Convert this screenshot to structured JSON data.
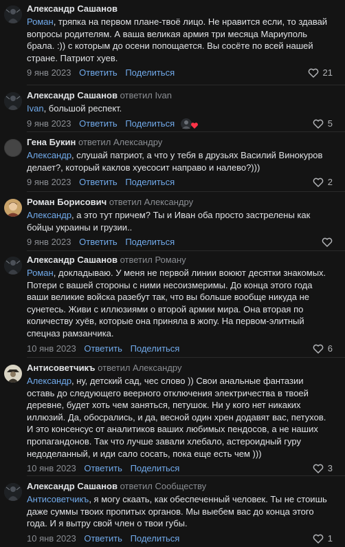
{
  "actions": {
    "reply": "Ответить",
    "share": "Поделиться"
  },
  "comments": [
    {
      "author": "Александр Сашанов",
      "reply_to": "",
      "mention": "Роман",
      "text": ", тряпка на первом плане-твоё лицо. Не нравится если, то здавай вопросы родителям. А ваша великая армия три месяца Мариуполь брала. :)) с которым до осени попощается. Вы сосёте по всей нашей стране. Патриот хуев.",
      "date": "9 янв 2023",
      "likes": "21",
      "avatar": "dark-figure-avatar"
    },
    {
      "author": "Александр Сашанов",
      "reply_to": "ответил Ivan",
      "mention": "Ivan",
      "text": ", большой респект.",
      "date": "9 янв 2023",
      "likes": "5",
      "avatar": "dark-figure-avatar"
    },
    {
      "author": "Гена Букин",
      "reply_to": "ответил Александру",
      "mention": "Александр",
      "text": ", слушай патриот, а что у тебя в друзьях Василий Винокуров делает?, который каклов хуесосит направо и налево?)))",
      "date": "9 янв 2023",
      "likes": "2",
      "avatar": "grey-circle-avatar"
    },
    {
      "author": "Роман Борисович",
      "reply_to": "ответил Александру",
      "mention": "Александр",
      "text": ", а это тут причем? Ты и Иван оба просто застрелены как бойцы украины и грузии..",
      "date": "9 янв 2023",
      "likes": "",
      "avatar": "person-photo-avatar"
    },
    {
      "author": "Александр Сашанов",
      "reply_to": "ответил Роману",
      "mention": "Роман",
      "text": ", докладываю. У меня не первой линии воюют десятки знакомых. Потери с вашей стороны с ними несоизмеримы. До конца этого года ваши великие войска разебут так, что вы больше вообще никуда не сунетесь. Живи с иллюзиями о второй армии мира. Она вторая по количеству хуёв, которые она приняла в жопу. На первом-элитный спецназ рамзанчика.",
      "date": "10 янв 2023",
      "likes": "6",
      "avatar": "dark-figure-avatar"
    },
    {
      "author": "Антисоветчикъ",
      "reply_to": "ответил Александру",
      "mention": "Александр",
      "text": ", ну, детский сад, чес слово )) Свои анальные фантазии оставь до следующего веерного отключения электричества в твоей деревне, будет хоть чем заняться, петушок. Ни у кого нет никаких иллюзий. Да, обосрались, и да, весной один хрен додавят вас, петухов. И это консенсус от аналитиков ваших любимых пендосов, а не наших пропагандонов. Так что лучше завали хлебало, астероидный гуру недоделанный, и иди сало сосать, пока еще есть чем )))",
      "date": "10 янв 2023",
      "likes": "3",
      "avatar": "hat-figure-avatar"
    },
    {
      "author": "Александр Сашанов",
      "reply_to": "ответил Сообществу",
      "mention": "Антисоветчикъ",
      "text": ", я могу скаать, как обеспеченный человек. Ты не стоишь даже суммы твоих пропитых органов. Мы выебем вас до конца этого года. И я вытру свой член о твои губы.",
      "date": "10 янв 2023",
      "likes": "1",
      "avatar": "dark-figure-avatar"
    }
  ],
  "colors": {
    "background": "#141414",
    "link": "#71aaeb",
    "secondary": "#8b8e93",
    "text": "#e1e3e6"
  },
  "icons": {
    "like": "heart-outline-icon",
    "liked_indicator": "heart-red-icon"
  }
}
